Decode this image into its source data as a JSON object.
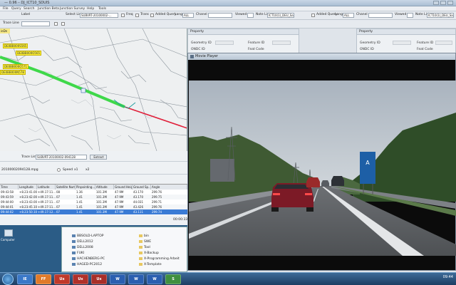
{
  "window": {
    "title": "— 0.96 – DJ_ICT10_SDUIS",
    "menu": [
      "File",
      "Query",
      "Search",
      "Junction Beta",
      "Junction Survey",
      "Help",
      "Tools"
    ]
  },
  "toolbar_left": {
    "select_list_label": "Select List",
    "select_list_value": "SUBVRT-20100002-…",
    "freq_label": "Freq",
    "trans_label": "Trans",
    "added_query_label": "Added Query",
    "lang_label": "Lang",
    "lang_value": "ALL",
    "chanel_label": "Chanel",
    "viewed_label": "Viewed",
    "note_list_label": "Note List",
    "note_list_value": "ICT10(1)_DEU_Sa…",
    "extra_left": "Label",
    "extra_left2": "Trace Line"
  },
  "toolbar_right": {
    "added_query_label": "Added Query",
    "lang_label": "Lang",
    "lang_value": "ALL",
    "chanel_label": "Chanel",
    "viewed_label": "Viewed",
    "note_list_label": "Note List",
    "note_list_value": "ICT10(1)_DEU_Sa…"
  },
  "map": {
    "tab_label": "ieDe",
    "labels": [
      "DE0BB000S565",
      "DE0BB000O565",
      "DE0BB000O571",
      "DE0BB000N578"
    ]
  },
  "property_panels": [
    {
      "header": "Property",
      "rows": [
        "Geometry ID",
        "ONDC ID",
        "Feature ID",
        "Feat Code"
      ]
    },
    {
      "header": "Property",
      "rows": [
        "Geometry ID",
        "ONDC ID",
        "Feature ID",
        "Feat Code"
      ]
    }
  ],
  "trace": {
    "trace_list_label": "Trace List",
    "trace_list_value": "SUBVRT-20100002-094128",
    "extract_button": "Extract",
    "filename": "20100002094128.mpg",
    "speed_label": "Speed",
    "speed_opt1": "x1",
    "speed_opt2": "x2",
    "time_readout": "00:00:33"
  },
  "table": {
    "columns": [
      "Time",
      "Longitude",
      "Latitude",
      "Satellite Num",
      "Pinpointing...",
      "Altitude",
      "Ground Height",
      "Ground Sp...",
      "Angle"
    ],
    "rows": [
      [
        "09:43:58",
        "+8.23:41.00...",
        "+49.17:11...",
        "08",
        "1.36",
        "101.3M",
        "47.9M",
        "43.170",
        "299.76"
      ],
      [
        "09:43:59",
        "+8.23:42.00...",
        "+49.17:11...",
        "07",
        "1.41",
        "101.3M",
        "47.9M",
        "43.170",
        "299.75"
      ],
      [
        "09:44:00",
        "+8.23:43.00...",
        "+49.17:11...",
        "07",
        "1.41",
        "101.3M",
        "47.9M",
        "44.031",
        "299.71"
      ],
      [
        "09:44:01",
        "+8.23:45.10...",
        "+49.17:11...",
        "07",
        "1.41",
        "101.3M",
        "47.9M",
        "43.426",
        "299.76"
      ],
      [
        "09:44:02",
        "+8.23:50.10...",
        "+49.17:12...",
        "07",
        "1.41",
        "101.3M",
        "47.9M",
        "43.111",
        "299.74"
      ]
    ]
  },
  "explorer": {
    "items": [
      "BBSOLD-LAPTOP",
      "DELL2012",
      "DELL2008",
      "FUKI",
      "HACHENBERG-PC",
      "HAGED-PC2012"
    ],
    "folders": [
      "bin",
      "SWE",
      "Tool",
      "X-Backup",
      "X-Programming Arbeit",
      "X-Template"
    ],
    "desktop_icon_label": "Computer"
  },
  "player": {
    "title": "Movie Player"
  },
  "video": {
    "sign_text": "A"
  },
  "taskbar": {
    "apps": [
      "IE",
      "FF",
      "Ux",
      "Ux",
      "Ux",
      "W",
      "W",
      "W",
      "S"
    ],
    "clock": "09:44"
  }
}
